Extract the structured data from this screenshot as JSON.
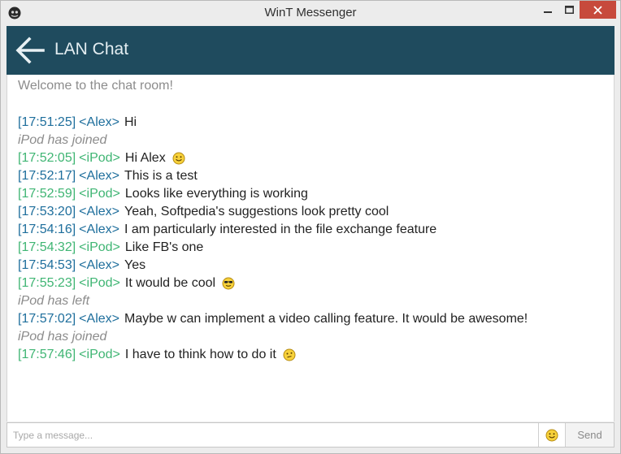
{
  "window": {
    "title": "WinT Messenger"
  },
  "header": {
    "title": "LAN Chat"
  },
  "chat": {
    "welcome": "Welcome to the chat room!",
    "messages": [
      {
        "kind": "msg",
        "user": "alex",
        "time": "[17:51:25]",
        "nick": "<Alex>",
        "text": "Hi"
      },
      {
        "kind": "event",
        "text": "iPod has joined"
      },
      {
        "kind": "msg",
        "user": "ipod",
        "time": "[17:52:05]",
        "nick": "<iPod>",
        "text": "Hi Alex",
        "emoji": "smile-emoji-icon"
      },
      {
        "kind": "msg",
        "user": "alex",
        "time": "[17:52:17]",
        "nick": "<Alex>",
        "text": "This is a test"
      },
      {
        "kind": "msg",
        "user": "ipod",
        "time": "[17:52:59]",
        "nick": "<iPod>",
        "text": "Looks like everything is working"
      },
      {
        "kind": "msg",
        "user": "alex",
        "time": "[17:53:20]",
        "nick": "<Alex>",
        "text": "Yeah, Softpedia's suggestions look pretty cool"
      },
      {
        "kind": "msg",
        "user": "alex",
        "time": "[17:54:16]",
        "nick": "<Alex>",
        "text": "I am particularly interested in the file exchange feature"
      },
      {
        "kind": "msg",
        "user": "ipod",
        "time": "[17:54:32]",
        "nick": "<iPod>",
        "text": "Like FB's one"
      },
      {
        "kind": "msg",
        "user": "alex",
        "time": "[17:54:53]",
        "nick": "<Alex>",
        "text": "Yes"
      },
      {
        "kind": "msg",
        "user": "ipod",
        "time": "[17:55:23]",
        "nick": "<iPod>",
        "text": "It would be cool",
        "emoji": "sunglasses-emoji-icon"
      },
      {
        "kind": "event",
        "text": "iPod has left"
      },
      {
        "kind": "msg",
        "user": "alex",
        "time": "[17:57:02]",
        "nick": "<Alex>",
        "text": "Maybe w can implement a video calling feature. It would be awesome!"
      },
      {
        "kind": "event",
        "text": "iPod has joined"
      },
      {
        "kind": "msg",
        "user": "ipod",
        "time": "[17:57:46]",
        "nick": "<iPod>",
        "text": "I have to think how to do it",
        "emoji": "thinking-emoji-icon"
      }
    ]
  },
  "input": {
    "placeholder": "Type a message...",
    "value": ""
  },
  "send_button": {
    "label": "Send"
  },
  "colors": {
    "header_bg": "#1f4b5e",
    "alex": "#1e6e9c",
    "ipod": "#3fb573",
    "close_button": "#c74a3c"
  }
}
